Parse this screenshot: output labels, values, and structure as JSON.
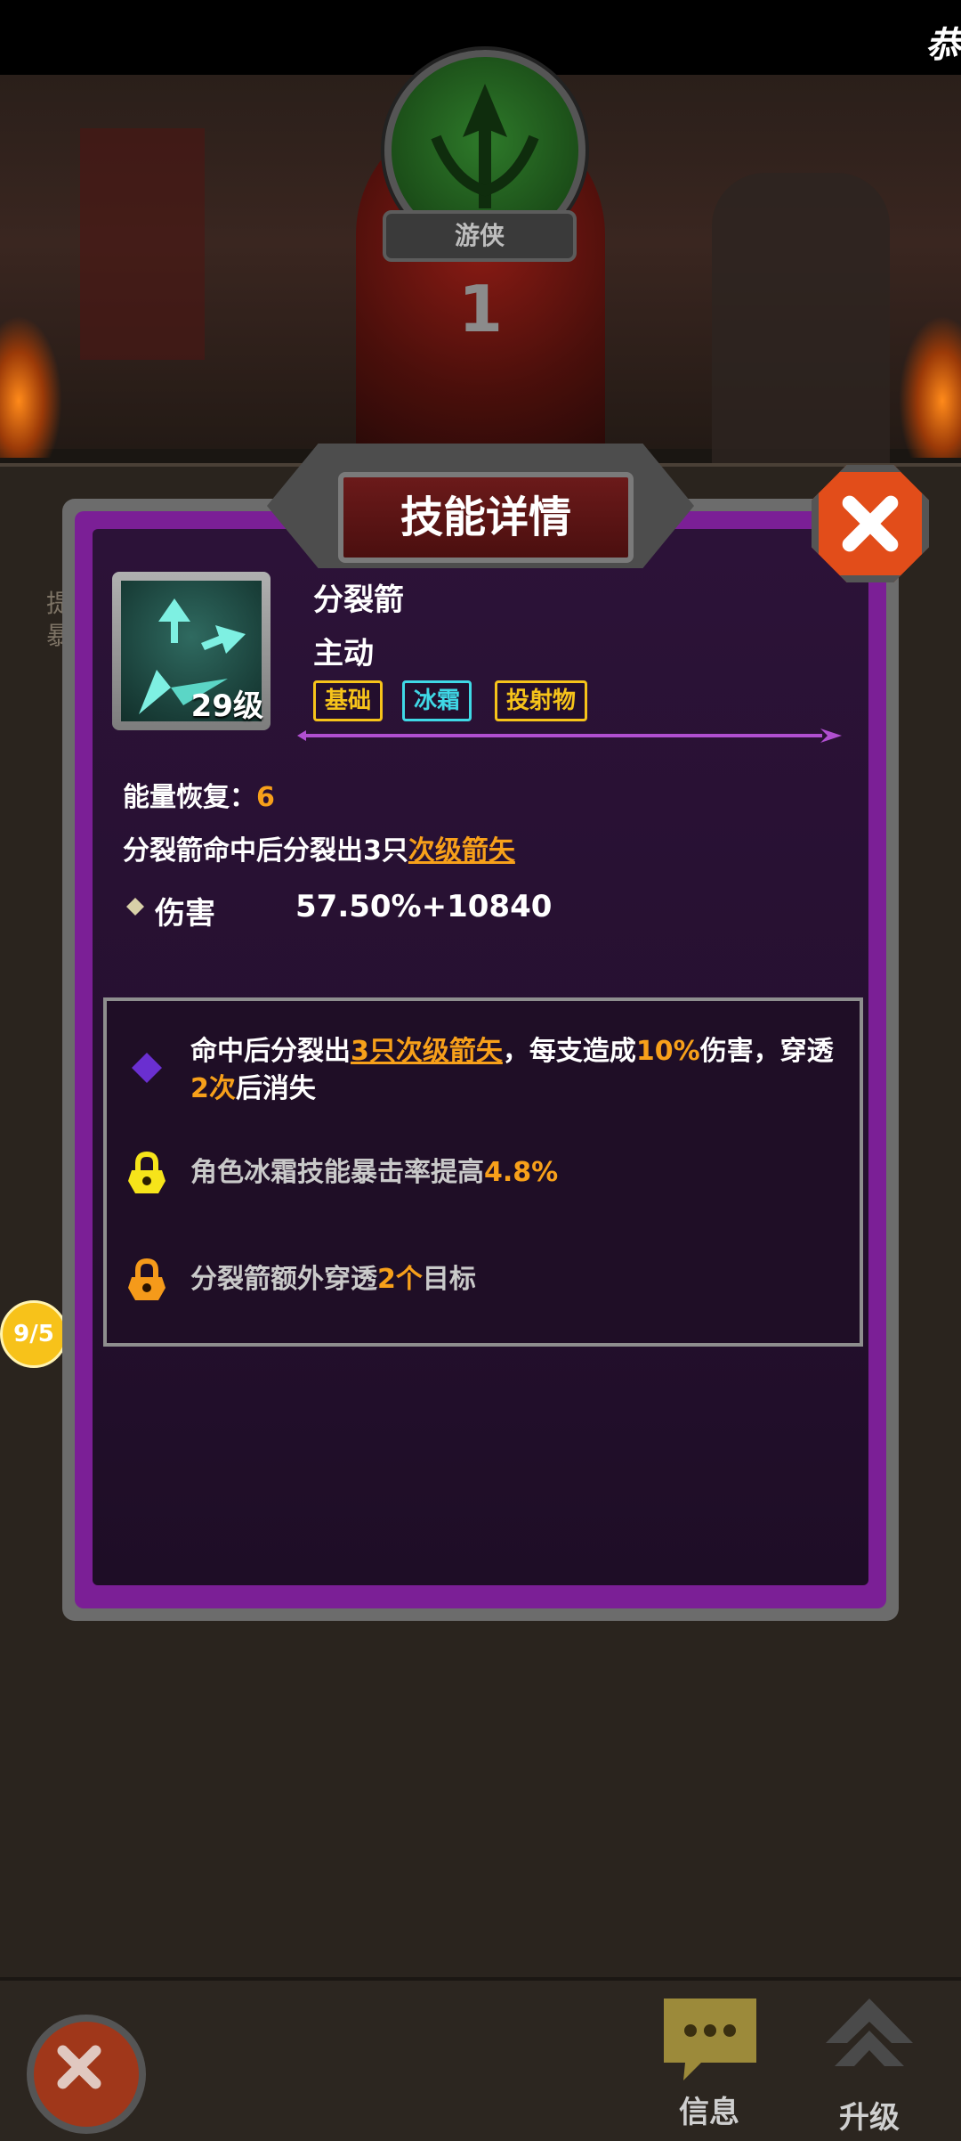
{
  "top": {
    "banner_text": "恭喜"
  },
  "hero": {
    "class_name": "游侠",
    "level": "1"
  },
  "under_panel": {
    "hint": "提暴"
  },
  "progress_badge": "9/5",
  "dialog": {
    "title": "技能详情",
    "skill": {
      "name": "分裂箭",
      "type": "主动",
      "level_label": "29级",
      "tags": [
        "基础",
        "冰霜",
        "投射物"
      ]
    },
    "energy": {
      "label": "能量恢复：",
      "value": "6"
    },
    "description": {
      "prefix": "分裂箭命中后分裂出3只",
      "highlight": "次级箭矢"
    },
    "stat": {
      "label": "伤害",
      "value": "57.50%+10840"
    },
    "upgrades": [
      {
        "parts": [
          "命中后分裂出",
          "3只次级箭矢",
          "，每支造成",
          "10%",
          "伤害，穿透",
          "2次",
          "后消失"
        ],
        "status": "unlocked"
      },
      {
        "parts": [
          "角色冰霜技能暴击率提高",
          "4.8%"
        ],
        "status": "locked-yellow"
      },
      {
        "parts": [
          "分裂箭额外穿透",
          "2个",
          "目标"
        ],
        "status": "locked-orange"
      }
    ]
  },
  "bottom": {
    "info_label": "信息",
    "upgrade_label": "升级"
  },
  "colors": {
    "accent_orange": "#f7a01a",
    "tag_yellow": "#f6c31a",
    "tag_cyan": "#3fd8e6",
    "frame_purple": "#7b1f96"
  }
}
